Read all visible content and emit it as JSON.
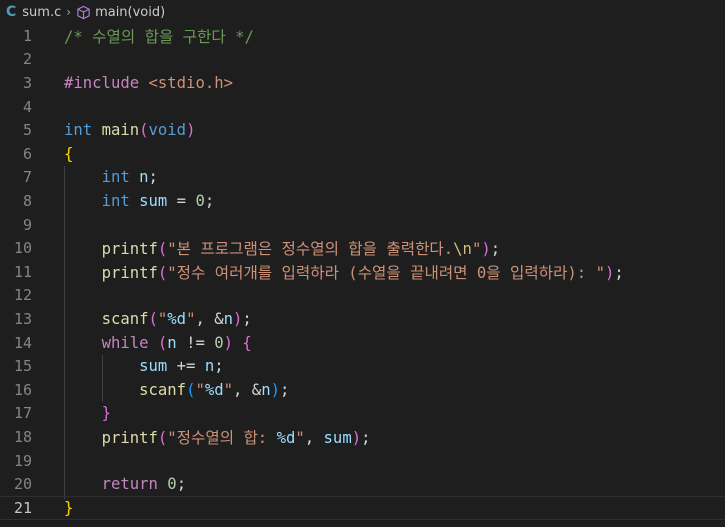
{
  "breadcrumb": {
    "lang_badge": "C",
    "file": "sum.c",
    "symbol": "main(void)"
  },
  "line_numbers": [
    "1",
    "2",
    "3",
    "4",
    "5",
    "6",
    "7",
    "8",
    "9",
    "10",
    "11",
    "12",
    "13",
    "14",
    "15",
    "16",
    "17",
    "18",
    "19",
    "20",
    "21"
  ],
  "current_line": "21",
  "code": {
    "l1": "/* 수열의 합을 구한다 */",
    "l3_kw": "#include",
    "l3_hdr": "<stdio.h>",
    "l5_type": "int",
    "l5_name": "main",
    "l5_arg": "void",
    "l7_type": "int",
    "l7_var": "n",
    "l8_type": "int",
    "l8_var": "sum",
    "l8_val": "0",
    "l10_fn": "printf",
    "l10_str": "\"본 프로그램은 정수열의 합을 출력한다.",
    "l10_esc": "\\n",
    "l10_end": "\"",
    "l11_fn": "printf",
    "l11_str": "\"정수 여러개를 입력하라 (수열을 끝내려면 ",
    "l11_num": "0",
    "l11_str2": "을 입력하라): \"",
    "l13_fn": "scanf",
    "l13_q1": "\"",
    "l13_fmt": "%d",
    "l13_q2": "\"",
    "l13_var": "n",
    "l14_kw": "while",
    "l14_var": "n",
    "l14_val": "0",
    "l15_var1": "sum",
    "l15_var2": "n",
    "l16_fn": "scanf",
    "l16_q1": "\"",
    "l16_fmt": "%d",
    "l16_q2": "\"",
    "l16_var": "n",
    "l18_fn": "printf",
    "l18_str": "\"정수열의 합: ",
    "l18_fmt": "%d",
    "l18_q": "\"",
    "l18_var": "sum",
    "l20_kw": "return",
    "l20_val": "0"
  },
  "colors": {
    "background": "#1e1e1e",
    "comment": "#6a9955",
    "keyword": "#569cd6",
    "function": "#dcdcaa",
    "string": "#ce9178",
    "variable": "#9cdcfe"
  },
  "icons": {
    "breadcrumb_separator": "chevron-right-icon",
    "symbol": "cube-method-icon"
  }
}
